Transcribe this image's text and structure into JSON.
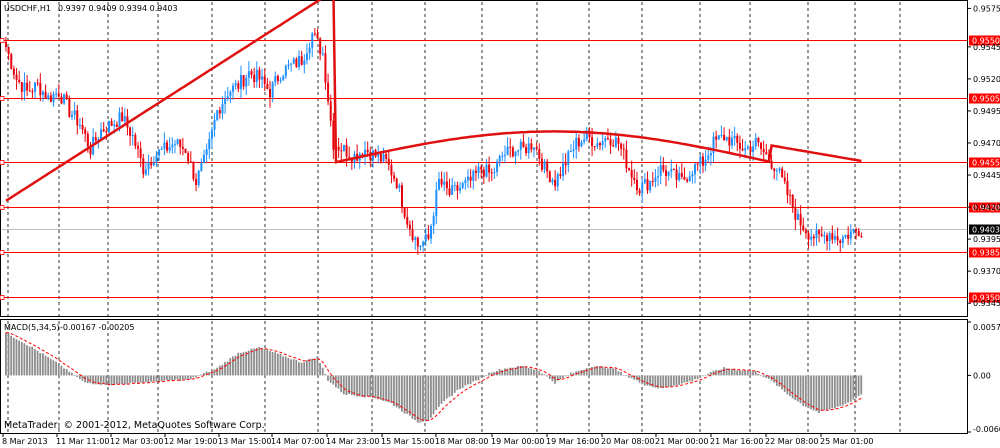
{
  "header": {
    "symbol": "USDCHF,H1",
    "ohlc": "0.9397 0.9409 0.9394 0.9403"
  },
  "macd": {
    "label": "MACD(5,34,5)",
    "values": "-0.00167 -0.00205"
  },
  "copyright": "MetaTrader, © 2001-2012, MetaQuotes Software Corp.",
  "colors": {
    "bull": "#1e90ff",
    "bear": "#e8000b",
    "level_line": "#ff0000",
    "ma_line": "#e01010",
    "signal_line": "#ff0000",
    "histogram": "#8c8c8c"
  },
  "chart_data": [
    {
      "type": "candlestick",
      "ylim": [
        0.9335,
        0.958
      ],
      "y_ticks": [
        "0.9575",
        "0.9545",
        "0.9520",
        "0.9495",
        "0.9470",
        "0.9445",
        "0.9420",
        "0.9395",
        "0.9370",
        "0.9345"
      ],
      "x_ticks": [
        "8 Mar 2013",
        "11 Mar 11:00",
        "12 Mar 03:00",
        "12 Mar 19:00",
        "13 Mar 15:00",
        "14 Mar 07:00",
        "14 Mar 23:00",
        "15 Mar 15:00",
        "18 Mar 08:00",
        "19 Mar 00:00",
        "19 Mar 16:00",
        "20 Mar 08:00",
        "21 Mar 00:00",
        "21 Mar 16:00",
        "22 Mar 08:00",
        "25 Mar 01:00"
      ],
      "levels": [
        "0.9550",
        "0.9505",
        "0.9455",
        "0.9420",
        "0.9385",
        "0.9350"
      ],
      "current_price": "0.9403",
      "close_path": [
        [
          0,
          0.9545
        ],
        [
          4,
          0.952
        ],
        [
          8,
          0.951
        ],
        [
          12,
          0.9515
        ],
        [
          16,
          0.9505
        ],
        [
          20,
          0.951
        ],
        [
          24,
          0.9495
        ],
        [
          28,
          0.9485
        ],
        [
          32,
          0.9465
        ],
        [
          36,
          0.948
        ],
        [
          40,
          0.9485
        ],
        [
          44,
          0.949
        ],
        [
          48,
          0.9475
        ],
        [
          52,
          0.945
        ],
        [
          56,
          0.946
        ],
        [
          60,
          0.9465
        ],
        [
          64,
          0.947
        ],
        [
          68,
          0.9465
        ],
        [
          72,
          0.944
        ],
        [
          76,
          0.946
        ],
        [
          80,
          0.9495
        ],
        [
          84,
          0.951
        ],
        [
          88,
          0.9515
        ],
        [
          92,
          0.9525
        ],
        [
          96,
          0.952
        ],
        [
          100,
          0.951
        ],
        [
          104,
          0.9525
        ],
        [
          108,
          0.953
        ],
        [
          112,
          0.9535
        ],
        [
          116,
          0.9555
        ],
        [
          120,
          0.954
        ],
        [
          124,
          0.947
        ],
        [
          128,
          0.9465
        ],
        [
          132,
          0.946
        ],
        [
          136,
          0.9465
        ],
        [
          140,
          0.946
        ],
        [
          144,
          0.9455
        ],
        [
          148,
          0.944
        ],
        [
          152,
          0.941
        ],
        [
          156,
          0.939
        ],
        [
          160,
          0.9395
        ],
        [
          164,
          0.944
        ],
        [
          168,
          0.943
        ],
        [
          172,
          0.9435
        ],
        [
          176,
          0.944
        ],
        [
          180,
          0.945
        ],
        [
          184,
          0.9445
        ],
        [
          188,
          0.946
        ],
        [
          192,
          0.9465
        ],
        [
          196,
          0.9465
        ],
        [
          200,
          0.947
        ],
        [
          204,
          0.945
        ],
        [
          208,
          0.944
        ],
        [
          212,
          0.9455
        ],
        [
          216,
          0.947
        ],
        [
          220,
          0.9475
        ],
        [
          224,
          0.947
        ],
        [
          228,
          0.9475
        ],
        [
          232,
          0.947
        ],
        [
          236,
          0.945
        ],
        [
          240,
          0.9435
        ],
        [
          244,
          0.944
        ],
        [
          248,
          0.945
        ],
        [
          252,
          0.9445
        ],
        [
          256,
          0.944
        ],
        [
          260,
          0.945
        ],
        [
          264,
          0.9455
        ],
        [
          268,
          0.947
        ],
        [
          272,
          0.9475
        ],
        [
          276,
          0.947
        ],
        [
          280,
          0.9465
        ],
        [
          284,
          0.947
        ],
        [
          288,
          0.946
        ],
        [
          292,
          0.945
        ],
        [
          296,
          0.943
        ],
        [
          300,
          0.941
        ],
        [
          304,
          0.94
        ],
        [
          308,
          0.9395
        ],
        [
          312,
          0.94
        ],
        [
          316,
          0.9395
        ],
        [
          320,
          0.94
        ],
        [
          324,
          0.9403
        ]
      ]
    },
    {
      "type": "bar",
      "name": "MACD(5,34,5)",
      "y_ticks": [
        "0.00573",
        "0.00",
        "-0.00607"
      ],
      "ylim": [
        -0.00607,
        0.00573
      ],
      "histogram": [
        [
          0,
          0.0046
        ],
        [
          10,
          0.003
        ],
        [
          20,
          0.0012
        ],
        [
          30,
          -0.0008
        ],
        [
          40,
          -0.001
        ],
        [
          50,
          -0.0008
        ],
        [
          60,
          -0.0006
        ],
        [
          70,
          -0.0004
        ],
        [
          80,
          0.0008
        ],
        [
          88,
          0.0024
        ],
        [
          96,
          0.003
        ],
        [
          104,
          0.0022
        ],
        [
          112,
          0.0014
        ],
        [
          118,
          0.002
        ],
        [
          122,
          -0.0005
        ],
        [
          128,
          -0.002
        ],
        [
          134,
          -0.0022
        ],
        [
          140,
          -0.0024
        ],
        [
          146,
          -0.003
        ],
        [
          152,
          -0.0042
        ],
        [
          156,
          -0.005
        ],
        [
          160,
          -0.0048
        ],
        [
          166,
          -0.0028
        ],
        [
          172,
          -0.0014
        ],
        [
          178,
          -0.0006
        ],
        [
          184,
          0.0004
        ],
        [
          190,
          0.0008
        ],
        [
          196,
          0.001
        ],
        [
          202,
          0.0005
        ],
        [
          208,
          -0.0008
        ],
        [
          214,
          0.0002
        ],
        [
          222,
          0.001
        ],
        [
          230,
          0.0008
        ],
        [
          236,
          -0.0002
        ],
        [
          242,
          -0.001
        ],
        [
          248,
          -0.0014
        ],
        [
          254,
          -0.001
        ],
        [
          260,
          -0.0006
        ],
        [
          266,
          0.0002
        ],
        [
          272,
          0.0008
        ],
        [
          278,
          0.0006
        ],
        [
          284,
          0.0004
        ],
        [
          290,
          -0.0006
        ],
        [
          296,
          -0.002
        ],
        [
          302,
          -0.0032
        ],
        [
          308,
          -0.004
        ],
        [
          314,
          -0.0035
        ],
        [
          320,
          -0.0028
        ],
        [
          324,
          -0.002
        ]
      ]
    }
  ]
}
